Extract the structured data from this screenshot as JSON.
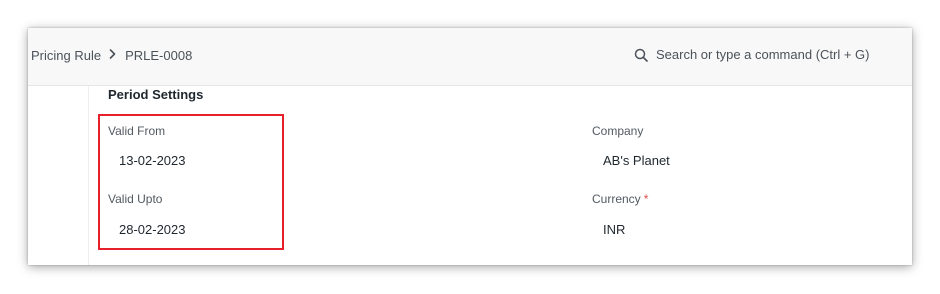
{
  "navbar": {
    "breadcrumb": [
      "Pricing Rule",
      "PRLE-0008"
    ],
    "search_placeholder": "Search or type a command (Ctrl + G)"
  },
  "section": {
    "title": "Period Settings"
  },
  "fields": {
    "valid_from": {
      "label": "Valid From",
      "value": "13-02-2023"
    },
    "valid_upto": {
      "label": "Valid Upto",
      "value": "28-02-2023"
    },
    "company": {
      "label": "Company",
      "value": "AB's Planet"
    },
    "currency": {
      "label": "Currency",
      "required_mark": "*",
      "value": "INR"
    }
  },
  "colors": {
    "highlight_border": "#e8202a",
    "required": "#e24c4c"
  }
}
